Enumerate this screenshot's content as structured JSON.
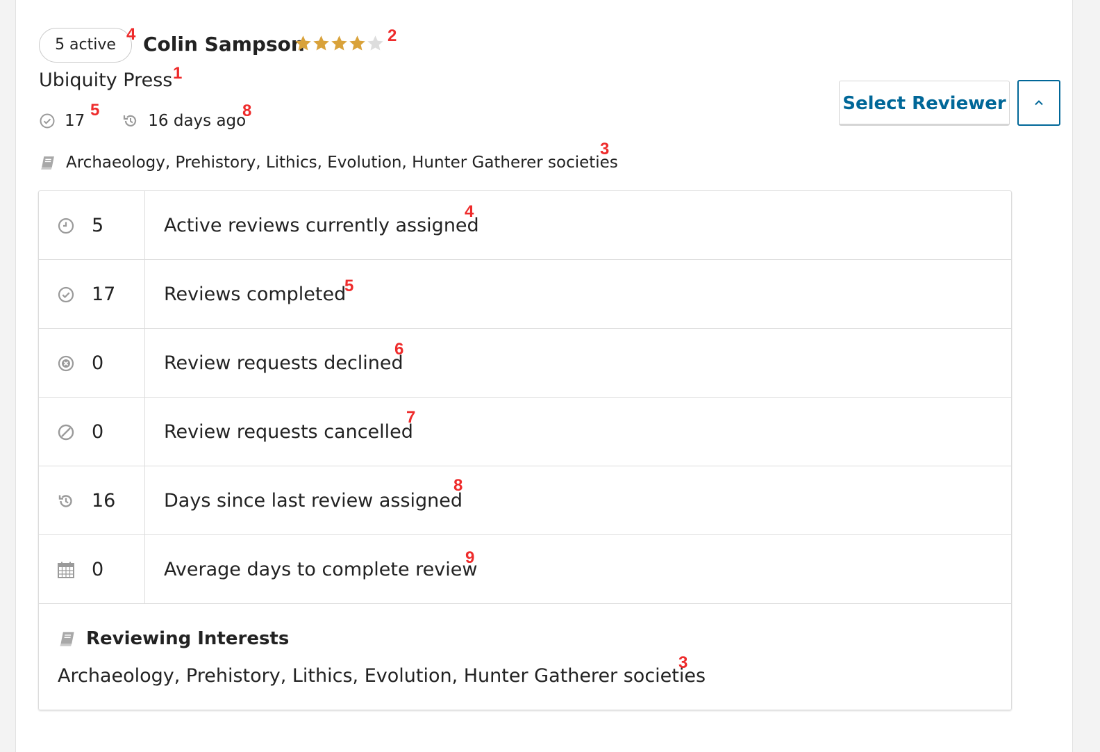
{
  "reviewer": {
    "active_badge": "5 active",
    "name": "Colin Sampson",
    "rating": 4,
    "rating_max": 5,
    "affiliation": "Ubiquity Press",
    "completed_count": "17",
    "last_assigned": "16 days ago",
    "interests": "Archaeology, Prehistory, Lithics, Evolution, Hunter Gatherer societies"
  },
  "actions": {
    "select_label": "Select Reviewer",
    "toggle_icon": "chevron-up-icon"
  },
  "stats": [
    {
      "icon": "clock-icon",
      "value": "5",
      "label": "Active reviews currently assigned",
      "marker": "4"
    },
    {
      "icon": "check-circle-icon",
      "value": "17",
      "label": "Reviews completed",
      "marker": "5"
    },
    {
      "icon": "times-circle-icon",
      "value": "0",
      "label": "Review requests declined",
      "marker": "6"
    },
    {
      "icon": "ban-icon",
      "value": "0",
      "label": "Review requests cancelled",
      "marker": "7"
    },
    {
      "icon": "history-icon",
      "value": "16",
      "label": "Days since last review assigned",
      "marker": "8"
    },
    {
      "icon": "calendar-icon",
      "value": "0",
      "label": "Average days to complete review",
      "marker": "9"
    }
  ],
  "reviewing_interests": {
    "title": "Reviewing Interests",
    "text": "Archaeology, Prehistory, Lithics, Evolution, Hunter Gatherer societies"
  },
  "annotations": {
    "badge": "4",
    "rating": "2",
    "affiliation": "1",
    "completed": "5",
    "last_assigned": "8",
    "interests": "3",
    "ri_text": "3"
  },
  "colors": {
    "accent": "#006798",
    "star_filled": "#d9a23a",
    "star_empty": "#dddddd",
    "annotation": "#ee2b2b",
    "icon_gray": "#9a9a9a"
  }
}
